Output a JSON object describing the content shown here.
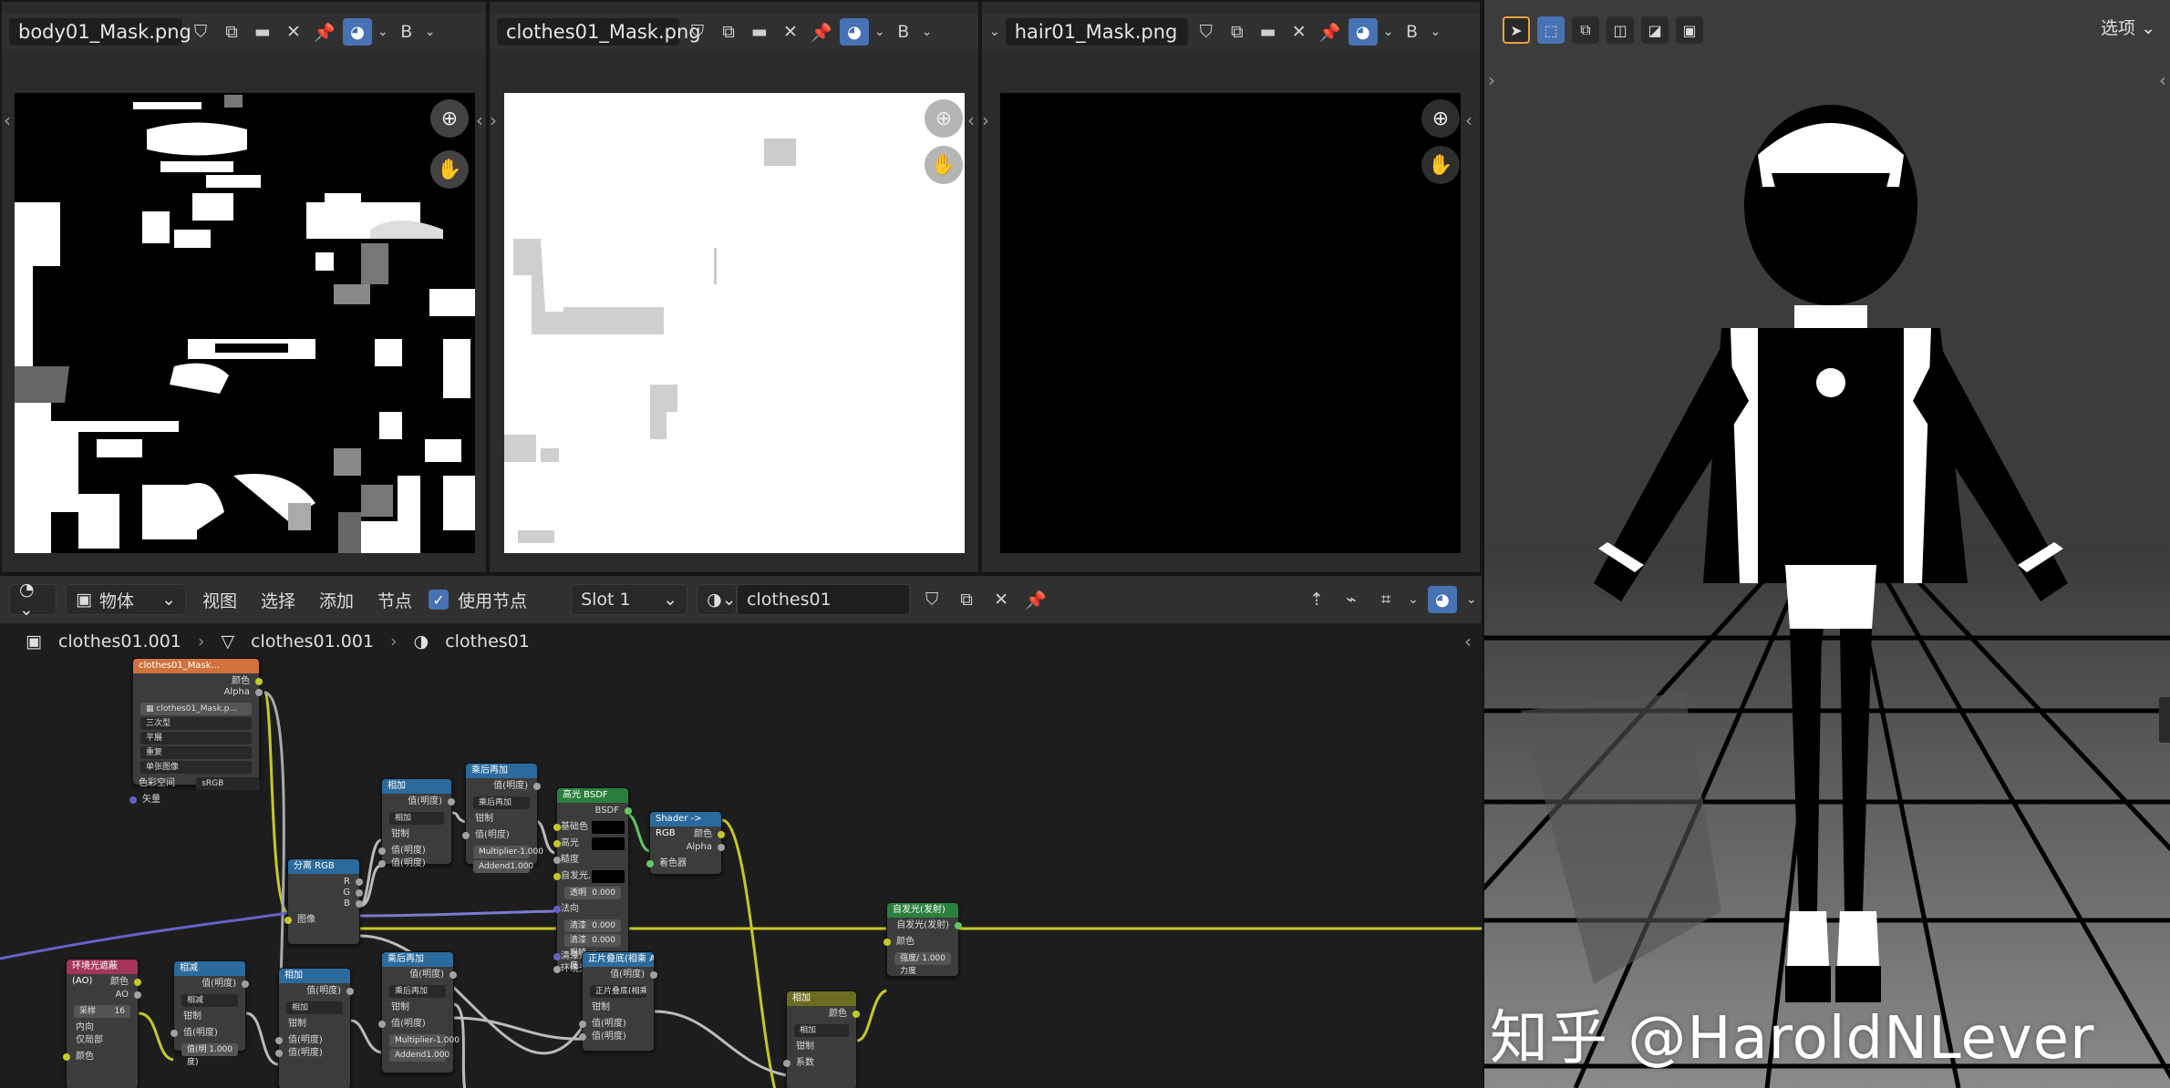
{
  "image_editors": [
    {
      "image_name": "body01_Mask.png"
    },
    {
      "image_name": "clothes01_Mask.png"
    },
    {
      "image_name": "hair01_Mask.png"
    }
  ],
  "node_editor": {
    "header": {
      "object_mode": "物体",
      "menus": [
        "视图",
        "选择",
        "添加",
        "节点"
      ],
      "use_nodes_label": "使用节点",
      "slot": "Slot 1",
      "material": "clothes01"
    },
    "breadcrumb": [
      "clothes01.001",
      "clothes01.001",
      "clothes01"
    ],
    "nodes": {
      "image_texture": {
        "title": "clothes01_Mask...",
        "out_color": "颜色",
        "out_alpha": "Alpha",
        "image": "clothes01_Mask.p...",
        "interp": "三次型",
        "projection": "平展",
        "extension": "重复",
        "alpha_mode": "单张图像",
        "colorspace_label": "色彩空间",
        "colorspace": "sRGB",
        "vector": "矢量"
      },
      "separate_rgb": {
        "title": "分离 RGB",
        "r": "R",
        "g": "G",
        "b": "B",
        "image": "图像"
      },
      "multiply1": {
        "title": "相加",
        "value": "值(明度)",
        "mode": "相加",
        "clamp": "钳制",
        "v1": "值(明度)",
        "v2": "值(明度)"
      },
      "multiply_add": {
        "title": "乘后再加",
        "value": "值(明度)",
        "mode": "乘后再加",
        "clamp": "钳制",
        "v1": "值(明度)",
        "multiplier_label": "Multiplier",
        "multiplier": "-1.000",
        "addend_label": "Addend",
        "addend": "1.000"
      },
      "specular_bsdf": {
        "title": "高光 BSDF",
        "bsdf": "BSDF",
        "base": "基础色",
        "spec": "高光",
        "rough": "糙度",
        "emit": "自发光...",
        "transp": "透明",
        "transp_v": "0.000",
        "normal": "法向",
        "cc": "清漆",
        "cc_v": "0.000",
        "ccr": "清漆粗糙度",
        "ccr_v": "0.000",
        "ccn": "清漆法线",
        "ao": "环境光遮蔽 (AO)"
      },
      "shader_rgb": {
        "title": "Shader -> RGB",
        "color": "颜色",
        "alpha": "Alpha",
        "shader": "着色器"
      },
      "ao": {
        "title": "环境光遮蔽 (AO)",
        "color": "颜色",
        "ao": "AO",
        "samples_label": "采样",
        "samples": "16",
        "inside": "内向",
        "only_local": "仅局部",
        "color_in": "颜色"
      },
      "subtract": {
        "title": "相减",
        "value": "值(明度)",
        "mode": "相减",
        "clamp": "钳制",
        "v1": "值(明度)",
        "v2_label": "值(明度)",
        "v2": "1.000"
      },
      "add2": {
        "title": "相加",
        "value": "值(明度)",
        "mode": "相加",
        "clamp": "钳制",
        "v1": "值(明度)",
        "v2": "值(明度)"
      },
      "multiply_add2": {
        "title": "乘后再加",
        "value": "值(明度)",
        "mode": "乘后再加",
        "clamp": "钳制",
        "v1": "值(明度)",
        "multiplier_label": "Multiplier",
        "multiplier": "-1.000",
        "addend_label": "Addend",
        "addend": "1.000"
      },
      "overlay": {
        "title": "正片叠底(相乘 A*B)",
        "value": "值(明度)",
        "mode": "正片叠底(相乘 A*B)",
        "clamp": "钳制",
        "v1": "值(明度)",
        "v2": "值(明度)"
      },
      "mix": {
        "title": "相加",
        "color": "颜色",
        "mode": "相加",
        "clamp": "钳制",
        "fac": "系数"
      },
      "emission": {
        "title": "自发光(发射)",
        "out": "自发光(发射)",
        "color": "颜色",
        "strength_label": "强度/力度",
        "strength": "1.000"
      }
    }
  },
  "viewport": {
    "options_label": "选项",
    "watermark": "知乎 @HaroldNLever"
  },
  "colors": {
    "accent": "#4772b3",
    "socket_yellow": "#c7c729",
    "socket_grey": "#a1a1a1",
    "socket_purple": "#6363c7",
    "socket_green": "#63c763",
    "header_texture": "#d1713c",
    "header_converter": "#2b6a9c",
    "header_shader": "#29803d",
    "header_input": "#a43558",
    "header_color": "#6c6c1f"
  }
}
